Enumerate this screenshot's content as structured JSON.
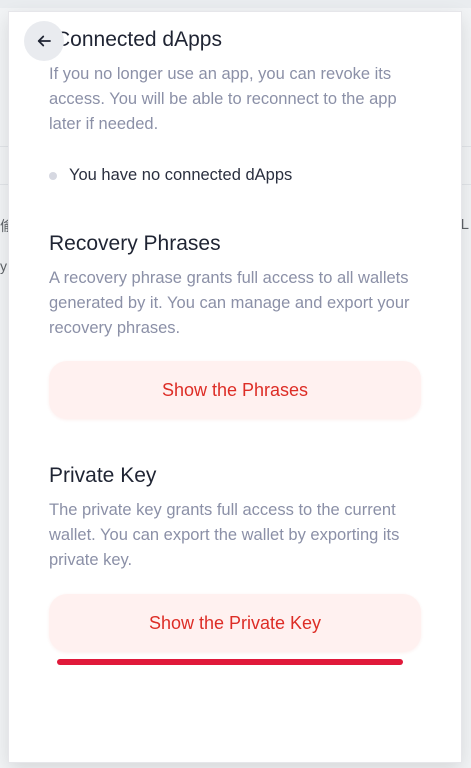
{
  "connected": {
    "title": "Connected dApps",
    "description": "If you no longer use an app, you can revoke its access. You will be able to reconnect to the app later if needed.",
    "empty_message": "You have no connected dApps"
  },
  "recovery": {
    "title": "Recovery Phrases",
    "description": "A recovery phrase grants full access to all wallets generated by it. You can manage and export your recovery phrases.",
    "button_label": "Show the Phrases"
  },
  "private_key": {
    "title": "Private Key",
    "description": "The private key grants full access to the current wallet. You can export the wallet by exporting its private key.",
    "button_label": "Show the Private Key"
  },
  "background": {
    "left_char_1": "偷",
    "left_char_2": "y",
    "right_char": "L"
  },
  "icons": {
    "back": "arrow-left-icon",
    "bullet": "dot-icon"
  },
  "colors": {
    "accent": "#dd2d26",
    "button_bg": "#fff1f0",
    "underline": "#e0193a",
    "muted_text": "#8b90a7"
  }
}
